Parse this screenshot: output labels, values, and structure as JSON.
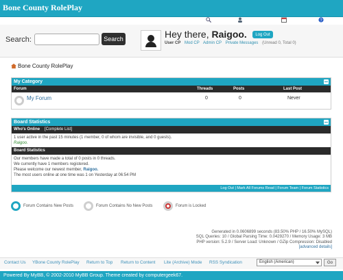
{
  "header": {
    "site_title": "Bone County RolePlay",
    "search_label": "Search:",
    "search_placeholder": "",
    "search_button": "Search",
    "greeting_prefix": "Hey there,",
    "username": "Raigoo.",
    "logout_label": "Log Out",
    "links": [
      "User CP",
      "Mod CP",
      "Admin CP",
      "Private Messages"
    ],
    "pm_status": "(Unread 0, Total 0)"
  },
  "breadcrumb": "Bone County RolePlay",
  "forum_table": {
    "category": "My Category",
    "columns": [
      "Forum",
      "Threads",
      "Posts",
      "Last Post"
    ],
    "rows": [
      {
        "name": "My Forum",
        "threads": "0",
        "posts": "0",
        "last_post": "Never"
      }
    ]
  },
  "stats": {
    "title": "Board Statistics",
    "whos_online_heading": "Who's Online",
    "complete_list": "[Complete List]",
    "online_text": "1 user active in the past 15 minutes (1 member, 0 of whom are invisible, and 0 guests).",
    "online_user": "Raigoo.",
    "board_stats_heading": "Board Statistics",
    "line1": "Our members have made a total of 0 posts in 0 threads.",
    "line2": "We currently have 1 members registered.",
    "line3_prefix": "Please welcome our newest member,",
    "newest_member": "Raigoo.",
    "line4": "The most users online at one time was 1 on Yesterday at 06:54 PM"
  },
  "footer_links": "Log Out | Mark All Forums Read | Forum Team | Forum Statistics",
  "legend": [
    "Forum Contains New Posts",
    "Forum Contains No New Posts",
    "Forum is Locked"
  ],
  "debug": [
    "Generated in 0.0606899 seconds (83.50% PHP / 16.50% MySQL)",
    "SQL Queries: 10 / Global Parsing Time: 0.0429270 / Memory Usage: 3 MB",
    "PHP version: 5.2.9 / Server Load: Unknown / GZip Compression: Disabled",
    "[advanced details]"
  ],
  "bottom_nav": [
    "Contact Us",
    "YBone County RolePlay",
    "Return to Top",
    "Return to Content",
    "Lite (Archive) Mode",
    "RSS Syndication"
  ],
  "language": "English (American)",
  "go_label": "Go",
  "copyright": "Powered By MyBB, © 2002-2010 MyBB Group. Theme created by computergeek67.",
  "colors": {
    "accent": "#1fa6c2",
    "dark": "#2b2b2b"
  }
}
